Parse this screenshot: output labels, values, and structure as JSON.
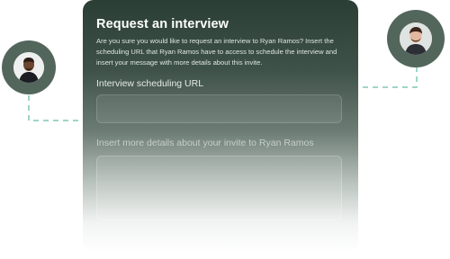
{
  "modal": {
    "title": "Request an interview",
    "description": "Are you sure you would like to request an interview to Ryan Ramos? Insert the scheduling URL that Ryan Ramos have to access to schedule the interview and insert your message with more details about this invite.",
    "url_field": {
      "label": "Interview scheduling URL",
      "value": "",
      "placeholder": ""
    },
    "details_field": {
      "label": "Insert more details about your invite to Ryan Ramos",
      "value": "",
      "placeholder": ""
    }
  },
  "avatars": {
    "sender": {
      "icon": "person-avatar-icon"
    },
    "recipient": {
      "icon": "person-avatar-icon"
    }
  },
  "colors": {
    "card_top": "#2b3e35",
    "avatar_ring": "#53665c",
    "connector_line": "#7ec7b5"
  }
}
